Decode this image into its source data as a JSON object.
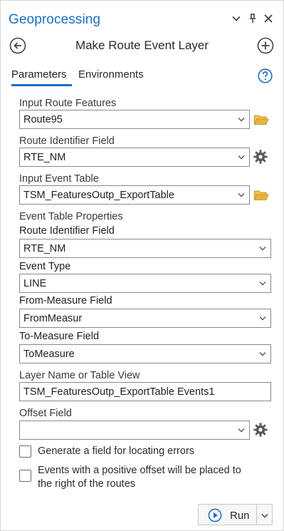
{
  "pane": {
    "title": "Geoprocessing",
    "controls": [
      "chevron-down-icon",
      "pin-icon",
      "close-icon"
    ]
  },
  "tool": {
    "title": "Make Route Event Layer",
    "back_icon": "back-arrow-icon",
    "add_icon": "plus-icon"
  },
  "tabs": [
    {
      "label": "Parameters",
      "active": true
    },
    {
      "label": "Environments",
      "active": false
    }
  ],
  "help_icon": "help-icon",
  "params": {
    "input_route_features": {
      "label": "Input Route Features",
      "value": "Route95"
    },
    "route_id_field": {
      "label": "Route Identifier Field",
      "value": "RTE_NM"
    },
    "input_event_table": {
      "label": "Input Event Table",
      "value": "TSM_FeaturesOutp_ExportTable"
    },
    "event_table_properties": {
      "label": "Event Table Properties"
    },
    "event_route_id_field": {
      "label": "Route Identifier Field",
      "value": "RTE_NM"
    },
    "event_type": {
      "label": "Event Type",
      "value": "LINE"
    },
    "from_measure_field": {
      "label": "From-Measure Field",
      "value": "FromMeasur"
    },
    "to_measure_field": {
      "label": "To-Measure Field",
      "value": "ToMeasure"
    },
    "layer_name": {
      "label": "Layer Name or Table View",
      "value": "TSM_FeaturesOutp_ExportTable Events1"
    },
    "offset_field": {
      "label": "Offset Field",
      "value": ""
    }
  },
  "checkboxes": {
    "locating_errors": {
      "label": "Generate a field for locating errors",
      "checked": false
    },
    "positive_offset": {
      "label_line1": "Events with a positive offset will be placed to",
      "label_line2": "the right of the routes",
      "checked": false
    }
  },
  "run": {
    "label": "Run"
  },
  "colors": {
    "accent": "#1b6ec2",
    "folder": "#e6b53b",
    "icon_gray": "#5a5a5a"
  }
}
